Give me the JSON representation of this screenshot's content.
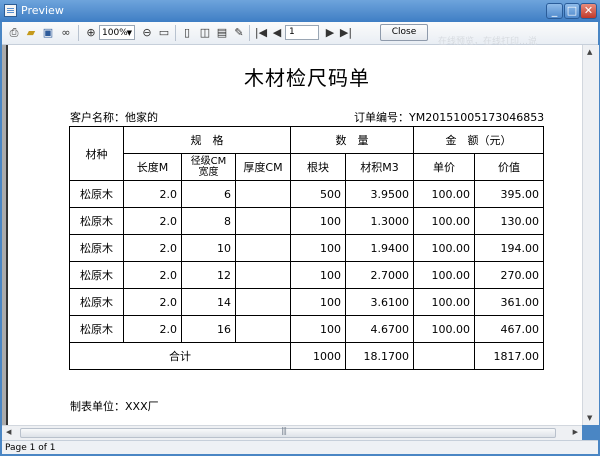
{
  "window": {
    "title": "Preview"
  },
  "toolbar": {
    "zoom": "100%",
    "page_input": "1",
    "close_label": "Close",
    "ghost_text": "在线预览，在线打印…说"
  },
  "document": {
    "title": "木材检尺码单",
    "customer_label": "客户名称：他家的",
    "order_label": "订单编号：YM20151005173046853",
    "maker_label": "制表单位：XXX厂",
    "headers": {
      "material": "材种",
      "spec": "规　格",
      "qty": "数　量",
      "amount": "金　额（元）",
      "length": "长度M",
      "diameter_line1": "径级CM",
      "diameter_line2": "宽度",
      "thickness": "厚度CM",
      "pieces": "根块",
      "volume": "材积M3",
      "unit_price": "单价",
      "value": "价值"
    },
    "rows": [
      {
        "material": "松原木",
        "length": "2.0",
        "diameter": "6",
        "thickness": "",
        "pieces": "500",
        "volume": "3.9500",
        "unit_price": "100.00",
        "value": "395.00"
      },
      {
        "material": "松原木",
        "length": "2.0",
        "diameter": "8",
        "thickness": "",
        "pieces": "100",
        "volume": "1.3000",
        "unit_price": "100.00",
        "value": "130.00"
      },
      {
        "material": "松原木",
        "length": "2.0",
        "diameter": "10",
        "thickness": "",
        "pieces": "100",
        "volume": "1.9400",
        "unit_price": "100.00",
        "value": "194.00"
      },
      {
        "material": "松原木",
        "length": "2.0",
        "diameter": "12",
        "thickness": "",
        "pieces": "100",
        "volume": "2.7000",
        "unit_price": "100.00",
        "value": "270.00"
      },
      {
        "material": "松原木",
        "length": "2.0",
        "diameter": "14",
        "thickness": "",
        "pieces": "100",
        "volume": "3.6100",
        "unit_price": "100.00",
        "value": "361.00"
      },
      {
        "material": "松原木",
        "length": "2.0",
        "diameter": "16",
        "thickness": "",
        "pieces": "100",
        "volume": "4.6700",
        "unit_price": "100.00",
        "value": "467.00"
      }
    ],
    "total": {
      "label": "合计",
      "pieces": "1000",
      "volume": "18.1700",
      "value": "1817.00"
    }
  },
  "status": {
    "text": "Page 1 of 1"
  }
}
